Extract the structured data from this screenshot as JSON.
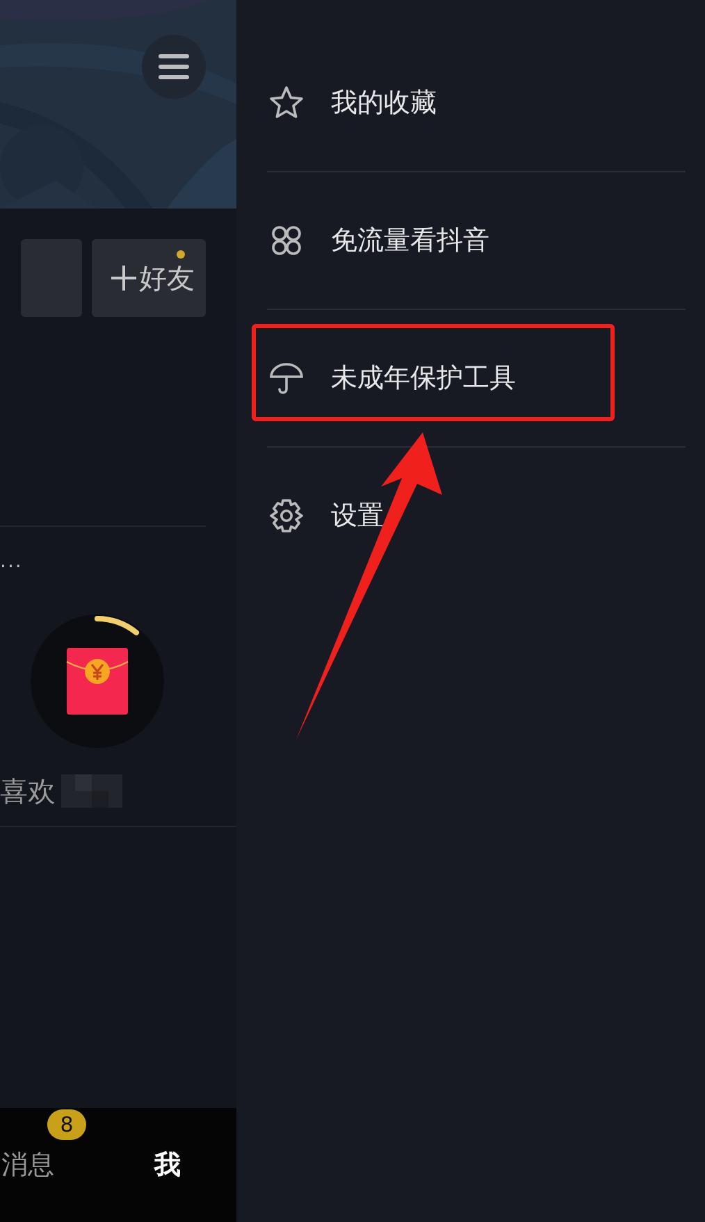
{
  "profile_panel": {
    "friend_button": {
      "label": "好友",
      "notification_dot": true
    },
    "overflow_text": "...",
    "likes_label": "喜欢"
  },
  "tab_bar": [
    {
      "label": "消息",
      "badge": "8",
      "selected": false
    },
    {
      "label": "我",
      "selected": true
    }
  ],
  "drawer_menu": [
    {
      "kind": "star",
      "label": "我的收藏",
      "highlighted": false
    },
    {
      "kind": "grid",
      "label": "免流量看抖音",
      "highlighted": false
    },
    {
      "kind": "umbrella",
      "label": "未成年保护工具",
      "highlighted": true
    },
    {
      "kind": "gear",
      "label": "设置",
      "highlighted": false
    }
  ],
  "pointer_arrow": true
}
